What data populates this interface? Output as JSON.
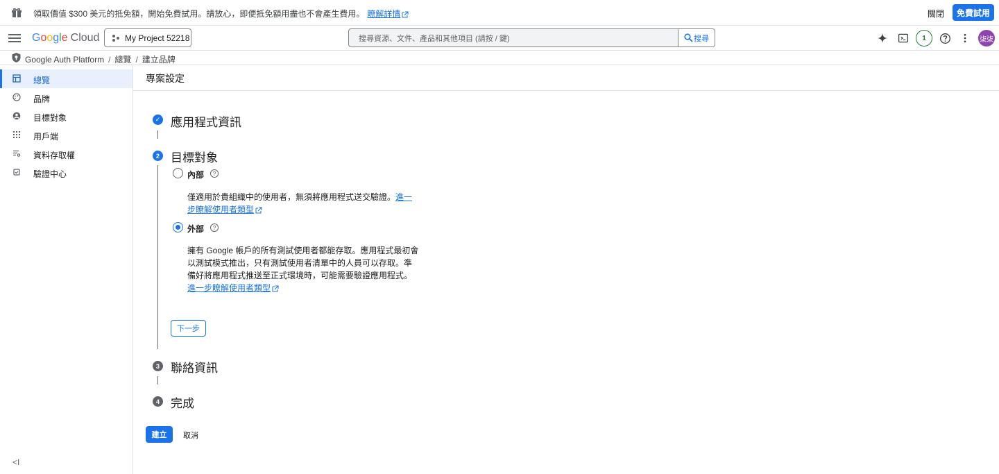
{
  "banner": {
    "text": "領取價值 $300 美元的抵免額，開始免費試用。請放心，即便抵免額用盡也不會產生費用。",
    "learn_more": "瞭解詳情",
    "close": "關閉",
    "try_free": "免費試用"
  },
  "header": {
    "logo_google": [
      "G",
      "o",
      "o",
      "g",
      "l",
      "e"
    ],
    "logo_cloud": "Cloud",
    "project": "My Project 52218",
    "search_placeholder": "搜尋資源、文件、產品和其他項目 (請按 / 鍵)",
    "search_button": "搜尋",
    "notifications": "1",
    "avatar": "柒柒"
  },
  "breadcrumb": {
    "items": [
      "Google Auth Platform",
      "總覽",
      "建立品牌"
    ],
    "separator": "/"
  },
  "sidebar": {
    "items": [
      {
        "label": "總覽",
        "icon": "dashboard-icon",
        "active": true
      },
      {
        "label": "品牌",
        "icon": "palette-icon",
        "active": false
      },
      {
        "label": "目標對象",
        "icon": "person-icon",
        "active": false
      },
      {
        "label": "用戶端",
        "icon": "grid-icon",
        "active": false
      },
      {
        "label": "資料存取權",
        "icon": "data-access-icon",
        "active": false
      },
      {
        "label": "驗證中心",
        "icon": "verify-icon",
        "active": false
      }
    ],
    "collapse_glyph": "<I"
  },
  "main": {
    "title": "專案設定",
    "steps": [
      {
        "label": "應用程式資訊",
        "marker": "✓"
      },
      {
        "label": "目標對象",
        "marker": "2"
      },
      {
        "label": "聯絡資訊",
        "marker": "3"
      },
      {
        "label": "完成",
        "marker": "4"
      }
    ],
    "audience": {
      "internal_label": "內部",
      "internal_desc": "僅適用於貴組織中的使用者，無須將應用程式送交驗證。",
      "internal_link": "進一步瞭解使用者類型",
      "external_label": "外部",
      "external_desc": "擁有 Google 帳戶的所有測試使用者都能存取。應用程式最初會以測試模式推出，只有測試使用者清單中的人員可以存取。準備好將應用程式推送至正式環境時，可能需要驗證應用程式。",
      "external_link": "進一步瞭解使用者類型",
      "selected": "external"
    },
    "next_button": "下一步",
    "create_button": "建立",
    "cancel_button": "取消"
  },
  "colors": {
    "accent": "#1a73e8",
    "active_bg": "#e8f0fe",
    "avatar_bg": "#8e44ad",
    "notif_green": "#188038"
  }
}
